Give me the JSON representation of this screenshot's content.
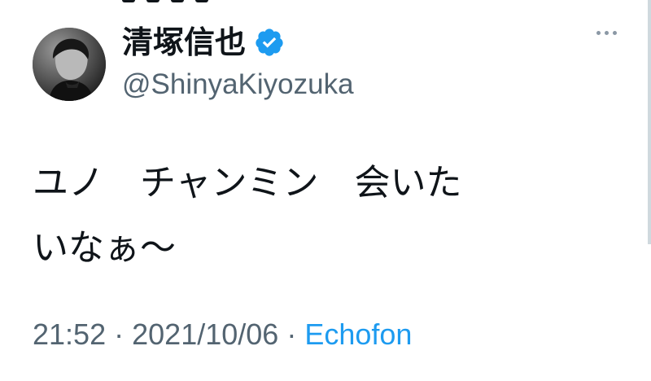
{
  "tweet": {
    "author": {
      "display_name": "清塚信也",
      "handle": "@ShinyaKiyozuka",
      "verified": true,
      "avatar_icon": "profile-photo"
    },
    "text": "ユノ　チャンミン　会いた\nいなぁ〜",
    "timestamp": "21:52",
    "date": "2021/10/06",
    "separator": "·",
    "source": "Echofon",
    "more_icon": "more-options-icon"
  },
  "colors": {
    "text_primary": "#0f1419",
    "text_secondary": "#536471",
    "accent": "#1d9bf0"
  }
}
